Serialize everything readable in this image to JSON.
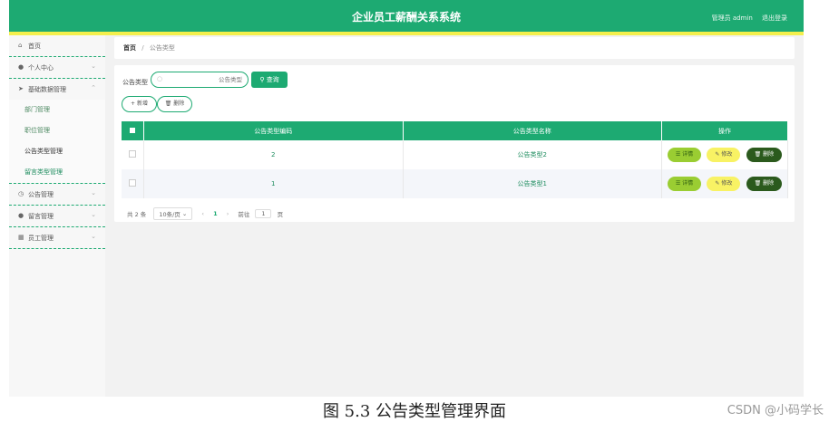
{
  "app": {
    "title": "企业员工薪酬关系系统",
    "user_label": "管理员 admin",
    "logout_label": "退出登录"
  },
  "sidebar": {
    "items": [
      {
        "label": "首页",
        "icon": "home-icon"
      },
      {
        "label": "个人中心",
        "icon": "user-icon"
      },
      {
        "label": "基础数据管理",
        "icon": "send-icon"
      },
      {
        "label": "公告管理",
        "icon": "clock-icon"
      },
      {
        "label": "留言管理",
        "icon": "user-icon"
      },
      {
        "label": "员工管理",
        "icon": "table-icon"
      }
    ],
    "sub_items": [
      {
        "label": "部门管理"
      },
      {
        "label": "职位管理"
      },
      {
        "label": "公告类型管理"
      },
      {
        "label": "留言类型管理"
      }
    ]
  },
  "breadcrumb": {
    "home": "首页",
    "separator": "/",
    "current": "公告类型"
  },
  "search": {
    "label": "公告类型",
    "placeholder": "公告类型",
    "button": "查询"
  },
  "actions": {
    "add": "新增",
    "delete": "删除"
  },
  "table": {
    "headers": [
      "公告类型编码",
      "公告类型名称",
      "操作"
    ],
    "rows": [
      {
        "code": "2",
        "name": "公告类型2"
      },
      {
        "code": "1",
        "name": "公告类型1"
      }
    ],
    "ops": {
      "detail": "详情",
      "edit": "修改",
      "delete": "删除"
    }
  },
  "pager": {
    "total": "共 2 条",
    "page_size": "10条/页",
    "current_page": "1",
    "goto_label": "前往",
    "goto_value": "1",
    "page_suffix": "页"
  },
  "caption": "图 5.3 公告类型管理界面",
  "watermark": "CSDN @小码学长",
  "colors": {
    "accent": "#1daa72",
    "topbar_border": "#f4ef4d",
    "detail_btn": "#9acd32",
    "edit_btn": "#f8f264",
    "delete_btn": "#2b5a1d"
  }
}
